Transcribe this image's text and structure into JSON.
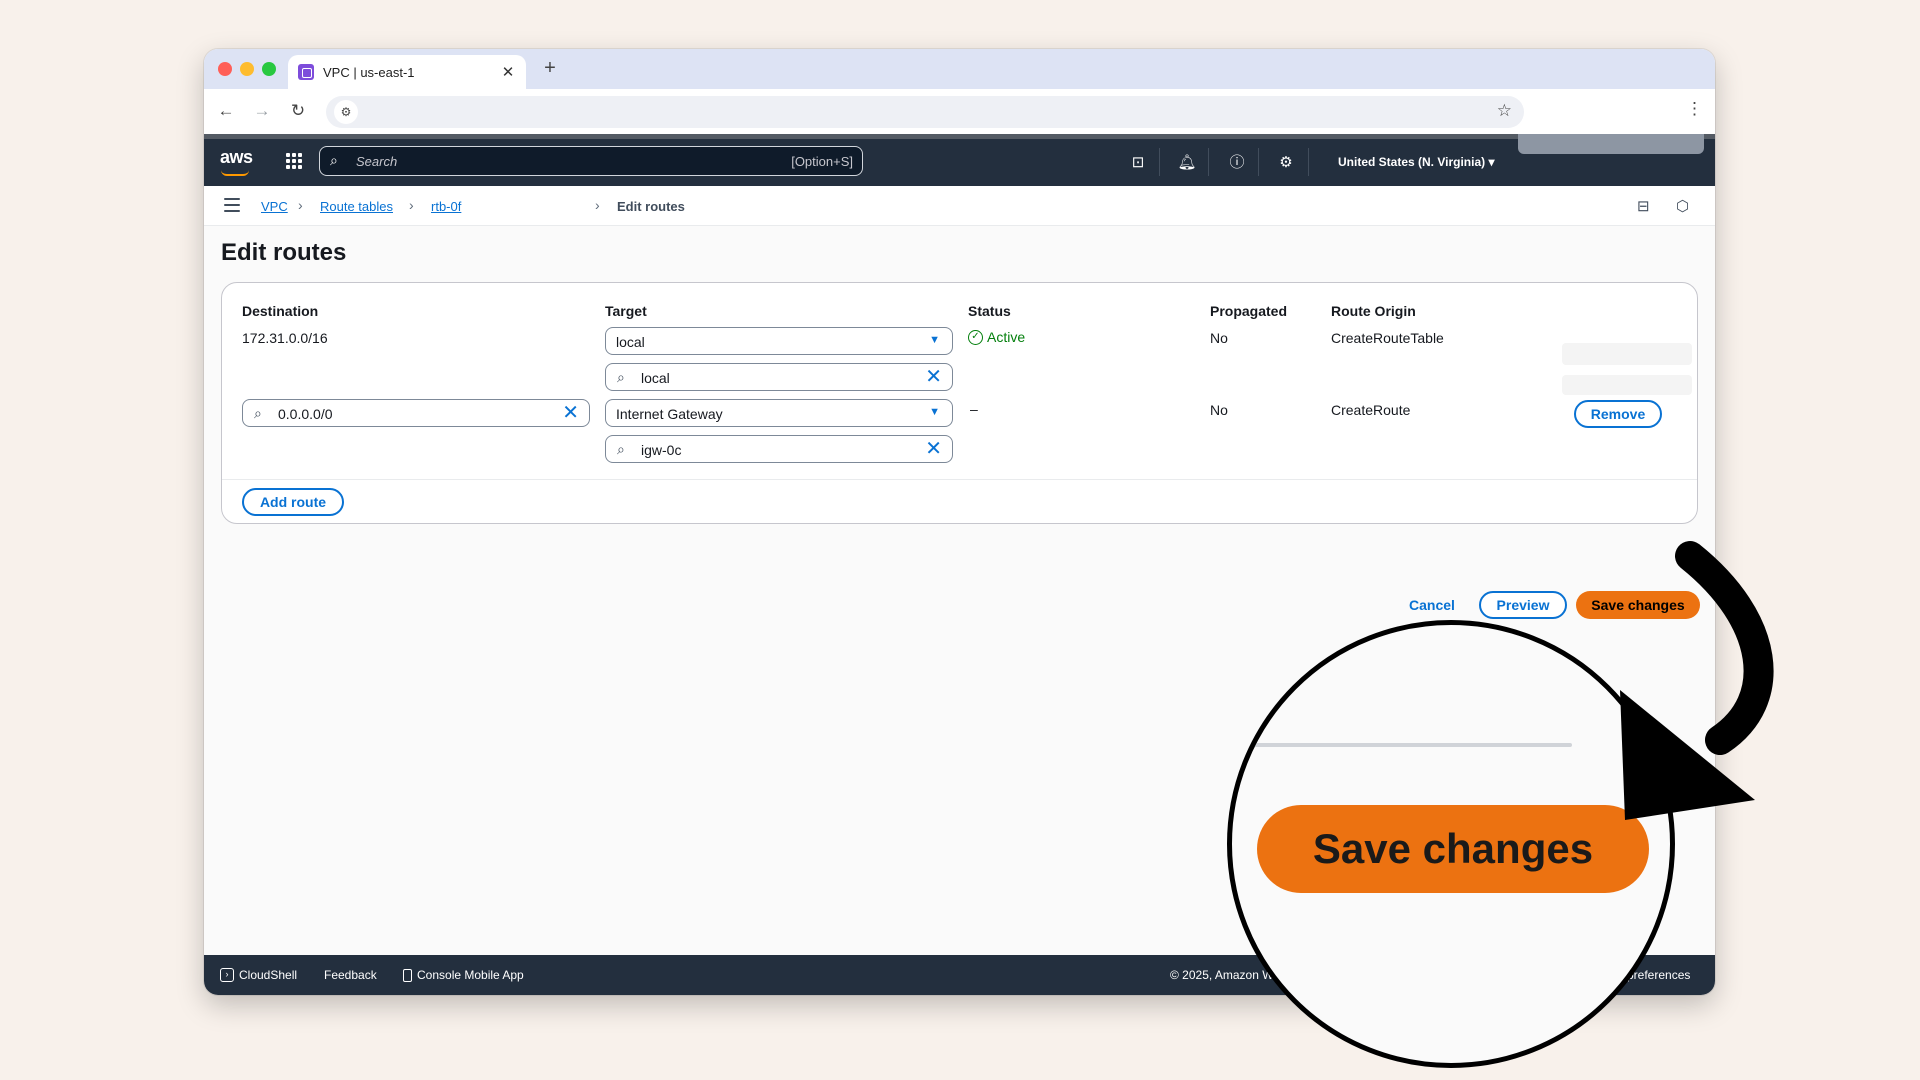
{
  "browser": {
    "tab_title": "VPC | us-east-1",
    "tab_close": "✕",
    "new_tab": "+"
  },
  "aws_nav": {
    "logo": "aws",
    "search_placeholder": "Search",
    "search_shortcut": "[Option+S]",
    "region": "United States (N. Virginia) ▾"
  },
  "breadcrumb": {
    "items": [
      "VPC",
      "Route tables",
      "rtb-0f"
    ],
    "current": "Edit routes"
  },
  "page": {
    "title": "Edit routes"
  },
  "routes_table": {
    "columns": [
      "Destination",
      "Target",
      "Status",
      "Propagated",
      "Route Origin"
    ],
    "rows": [
      {
        "destination": "172.31.0.0/16",
        "target": "local",
        "target_filter": "local",
        "status": "Active",
        "propagated": "No",
        "origin": "CreateRouteTable"
      },
      {
        "destination": "0.0.0.0/0",
        "target": "Internet Gateway",
        "target_filter": "igw-0c",
        "status": "–",
        "propagated": "No",
        "origin": "CreateRoute",
        "remove_label": "Remove"
      }
    ],
    "add_route_label": "Add route"
  },
  "actions": {
    "cancel": "Cancel",
    "preview": "Preview",
    "save": "Save changes"
  },
  "footer": {
    "cloudshell": "CloudShell",
    "feedback": "Feedback",
    "mobile_app": "Console Mobile App",
    "copyright": "© 2025, Amazon W",
    "preferences": "e preferences"
  },
  "zoom_callout": {
    "label": "Save changes"
  },
  "colors": {
    "aws_dark": "#232f3e",
    "link_blue": "#0972d3",
    "primary_orange": "#ec7211",
    "success_green": "#037f0c"
  }
}
